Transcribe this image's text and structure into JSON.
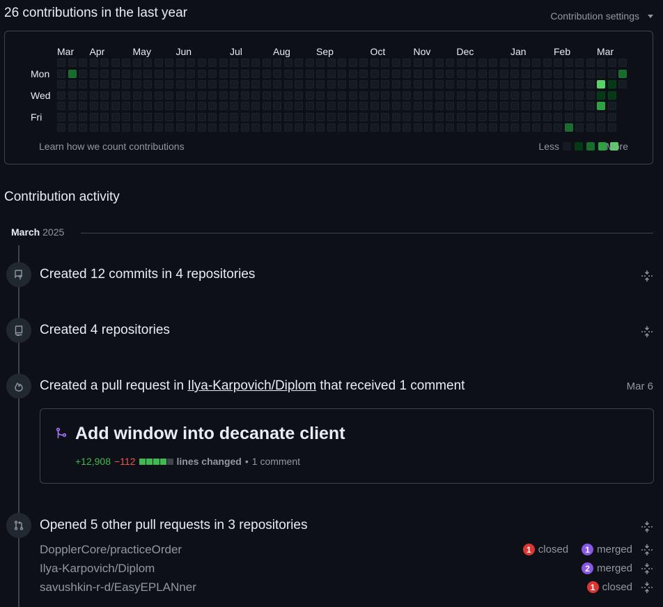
{
  "header": {
    "title": "26 contributions in the last year",
    "settings_label": "Contribution settings"
  },
  "graph": {
    "months": [
      {
        "label": "Mar",
        "week": 0
      },
      {
        "label": "Apr",
        "week": 3
      },
      {
        "label": "May",
        "week": 7
      },
      {
        "label": "Jun",
        "week": 11
      },
      {
        "label": "Jul",
        "week": 16
      },
      {
        "label": "Aug",
        "week": 20
      },
      {
        "label": "Sep",
        "week": 24
      },
      {
        "label": "Oct",
        "week": 29
      },
      {
        "label": "Nov",
        "week": 33
      },
      {
        "label": "Dec",
        "week": 37
      },
      {
        "label": "Jan",
        "week": 42
      },
      {
        "label": "Feb",
        "week": 46
      },
      {
        "label": "Mar",
        "week": 50
      }
    ],
    "days": [
      "Mon",
      "Wed",
      "Fri"
    ],
    "weeks": 53,
    "active_cells": [
      {
        "week": 1,
        "day": 1,
        "level": 2
      },
      {
        "week": 47,
        "day": 6,
        "level": 2
      },
      {
        "week": 50,
        "day": 2,
        "level": 4
      },
      {
        "week": 50,
        "day": 3,
        "level": 1
      },
      {
        "week": 50,
        "day": 4,
        "level": 3
      },
      {
        "week": 51,
        "day": 2,
        "level": 1
      },
      {
        "week": 51,
        "day": 3,
        "level": 1
      },
      {
        "week": 52,
        "day": 1,
        "level": 2
      }
    ],
    "level_colors": [
      "#151b23",
      "#033a16",
      "#196c2e",
      "#2ea043",
      "#56d364"
    ],
    "learn_link": "Learn how we count contributions",
    "less_label": "Less",
    "more_label": "More"
  },
  "activity": {
    "title": "Contribution activity",
    "month": "March",
    "year": "2025",
    "events": [
      {
        "text": "Created 12 commits in 4 repositories"
      },
      {
        "text": "Created 4 repositories"
      },
      {
        "prefix": "Created a pull request in ",
        "repo": "Ilya-Karpovich/Diplom",
        "suffix": " that received 1 comment",
        "date": "Mar 6"
      },
      {
        "text": "Opened 5 other pull requests in 3 repositories"
      }
    ],
    "pull_request": {
      "title": "Add window into decanate client",
      "additions": "+12,908",
      "deletions": "−112",
      "lines_label": "lines changed",
      "separator": "•",
      "comments": "1 comment"
    },
    "other_prs": [
      {
        "repo": "DopplerCore/practiceOrder",
        "closed": "1",
        "closed_label": "closed",
        "merged": "1",
        "merged_label": "merged"
      },
      {
        "repo": "Ilya-Karpovich/Diplom",
        "merged": "2",
        "merged_label": "merged"
      },
      {
        "repo": "savushkin-r-d/EasyEPLANner",
        "closed": "1",
        "closed_label": "closed"
      }
    ]
  }
}
